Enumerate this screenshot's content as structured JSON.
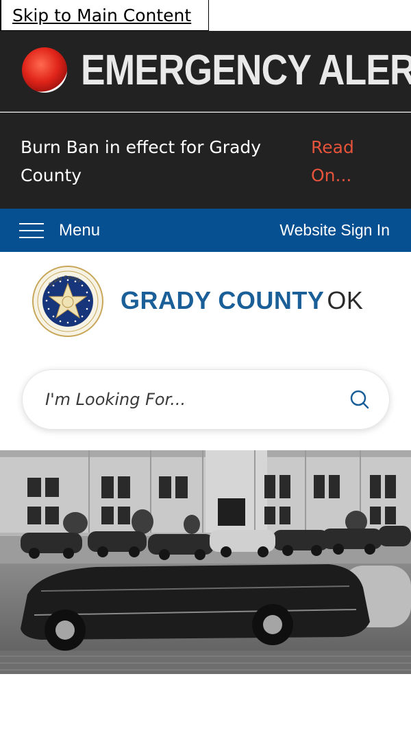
{
  "skip_link": "Skip to Main Content",
  "alert": {
    "title": "EMERGENCY ALERT",
    "message": "Burn Ban in effect for Grady County",
    "read_more": "Read On..."
  },
  "nav": {
    "menu_label": "Menu",
    "sign_in": "Website Sign In"
  },
  "brand": {
    "county": "GRADY COUNTY",
    "state": "OK",
    "seal_text_top": "Grady County",
    "seal_text_bottom": "Oklahoma"
  },
  "search": {
    "placeholder": "I'm Looking For..."
  },
  "colors": {
    "alert_bg": "#222222",
    "read_more": "#e5533b",
    "nav_bg": "#065092",
    "brand_blue": "#1a5f98"
  }
}
